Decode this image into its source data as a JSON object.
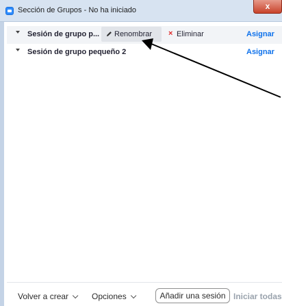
{
  "window": {
    "title": "Sección de Grupos - No ha iniciado",
    "close_glyph": "x"
  },
  "rooms": [
    {
      "name": "Sesión de grupo p...",
      "actions": {
        "rename_label": "Renombrar",
        "delete_label": "Eliminar",
        "delete_glyph": "×"
      },
      "assign_label": "Asignar"
    },
    {
      "name": "Sesión de grupo pequeño 2",
      "assign_label": "Asignar"
    }
  ],
  "footer": {
    "recreate_label": "Volver a crear",
    "options_label": "Opciones",
    "add_session_label": "Añadir una sesión",
    "start_all_label": "Iniciar todas"
  },
  "icons": {
    "app": "zoom-app-icon",
    "expand": "caret-down-icon",
    "rename": "pencil-icon",
    "delete": "close-x-icon",
    "dropdown": "chevron-down-icon"
  },
  "colors": {
    "accent_blue": "#0e71eb",
    "delete_red": "#e02828",
    "disabled_gray": "#9aa3ad",
    "titlebar": "#d7e3f1",
    "annotation_arrow": "#000000"
  }
}
